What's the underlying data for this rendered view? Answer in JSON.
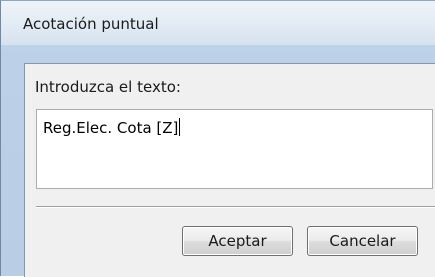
{
  "window": {
    "title": "Acotación puntual"
  },
  "form": {
    "prompt_label": "Introduzca el texto:",
    "text_value": "Reg.Elec. Cota [Z]"
  },
  "buttons": {
    "accept_label": "Aceptar",
    "cancel_label": "Cancelar"
  }
}
